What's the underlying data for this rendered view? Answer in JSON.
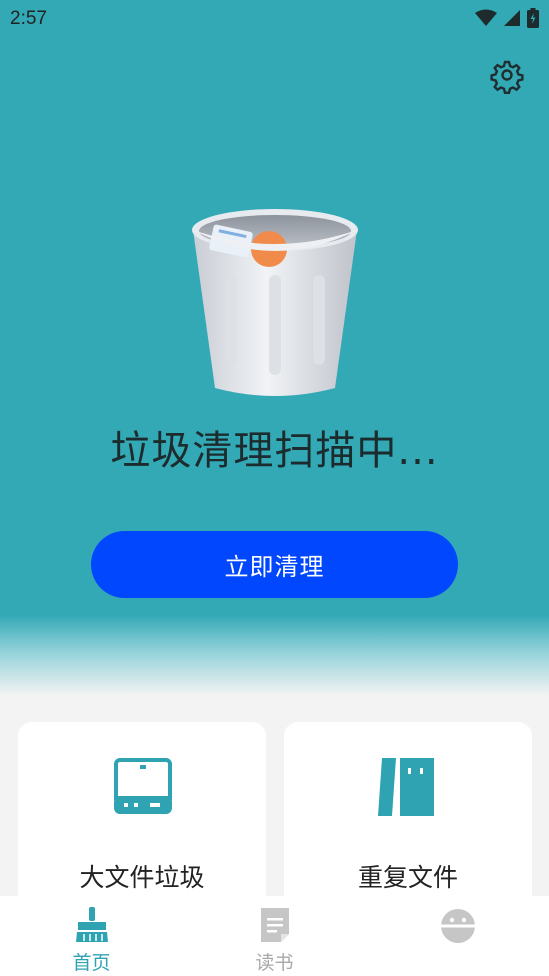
{
  "status_bar": {
    "time": "2:57",
    "icons": [
      "wifi-icon",
      "signal-icon",
      "battery-icon"
    ]
  },
  "header": {
    "settings_icon": "gear-icon"
  },
  "hero": {
    "scan_status": "垃圾清理扫描中...",
    "clean_button": "立即清理",
    "colors": {
      "background": "#33a9b6",
      "button": "#0047fe"
    }
  },
  "cards": [
    {
      "label": "大文件垃圾",
      "icon": "hard-drive-icon"
    },
    {
      "label": "重复文件",
      "icon": "duplicate-files-icon"
    }
  ],
  "bottom_nav": {
    "items": [
      {
        "label": "首页",
        "icon": "broom-icon",
        "active": true
      },
      {
        "label": "读书",
        "icon": "document-icon",
        "active": false
      },
      {
        "label": "",
        "icon": "robot-face-icon",
        "active": false
      }
    ],
    "colors": {
      "active": "#2fa3b2",
      "inactive": "#a9a9a9"
    }
  }
}
